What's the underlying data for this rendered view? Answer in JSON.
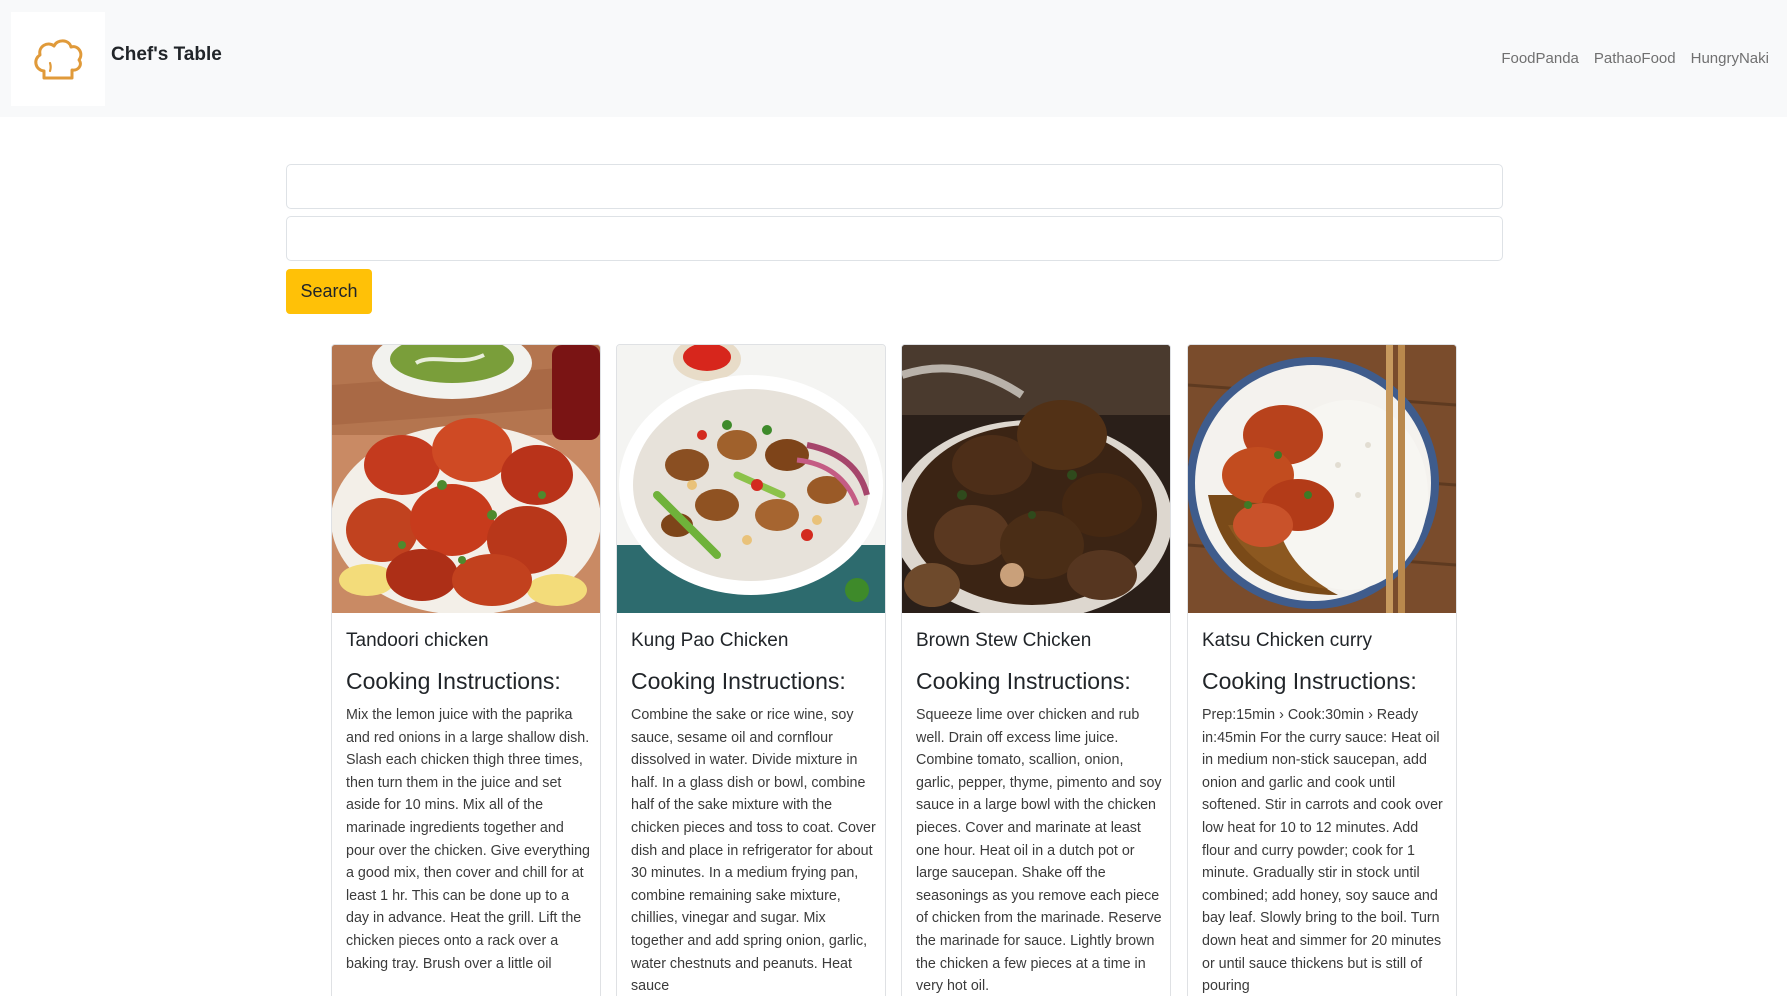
{
  "header": {
    "brand": "Chef's Table",
    "logo_icon": "chef-hat-icon",
    "nav_links": [
      "FoodPanda",
      "PathaoFood",
      "HungryNaki"
    ]
  },
  "search": {
    "input1_value": "",
    "input2_value": "",
    "button_label": "Search"
  },
  "colors": {
    "accent": "#ffc107",
    "navbar_bg": "#f8f9fa",
    "logo": "#e09a3a"
  },
  "recipes": [
    {
      "title": "Tandoori chicken",
      "subtitle": "Cooking Instructions:",
      "image": "tandoori-chicken-photo",
      "instructions": "Mix the lemon juice with the paprika and red onions in a large shallow dish. Slash each chicken thigh three times, then turn them in the juice and set aside for 10 mins. Mix all of the marinade ingredients together and pour over the chicken. Give everything a good mix, then cover and chill for at least 1 hr. This can be done up to a day in advance. Heat the grill. Lift the chicken pieces onto a rack over a baking tray. Brush over a little oil"
    },
    {
      "title": "Kung Pao Chicken",
      "subtitle": "Cooking Instructions:",
      "image": "kung-pao-chicken-photo",
      "instructions": "Combine the sake or rice wine, soy sauce, sesame oil and cornflour dissolved in water. Divide mixture in half. In a glass dish or bowl, combine half of the sake mixture with the chicken pieces and toss to coat. Cover dish and place in refrigerator for about 30 minutes. In a medium frying pan, combine remaining sake mixture, chillies, vinegar and sugar. Mix together and add spring onion, garlic, water chestnuts and peanuts. Heat sauce"
    },
    {
      "title": "Brown Stew Chicken",
      "subtitle": "Cooking Instructions:",
      "image": "brown-stew-chicken-photo",
      "instructions": "Squeeze lime over chicken and rub well. Drain off excess lime juice. Combine tomato, scallion, onion, garlic, pepper, thyme, pimento and soy sauce in a large bowl with the chicken pieces. Cover and marinate at least one hour. Heat oil in a dutch pot or large saucepan. Shake off the seasonings as you remove each piece of chicken from the marinade. Reserve the marinade for sauce. Lightly brown the chicken a few pieces at a time in very hot oil."
    },
    {
      "title": "Katsu Chicken curry",
      "subtitle": "Cooking Instructions:",
      "image": "katsu-chicken-curry-photo",
      "instructions": "Prep:15min › Cook:30min › Ready in:45min For the curry sauce: Heat oil in medium non-stick saucepan, add onion and garlic and cook until softened. Stir in carrots and cook over low heat for 10 to 12 minutes. Add flour and curry powder; cook for 1 minute. Gradually stir in stock until combined; add honey, soy sauce and bay leaf. Slowly bring to the boil. Turn down heat and simmer for 20 minutes or until sauce thickens but is still of pouring"
    }
  ]
}
